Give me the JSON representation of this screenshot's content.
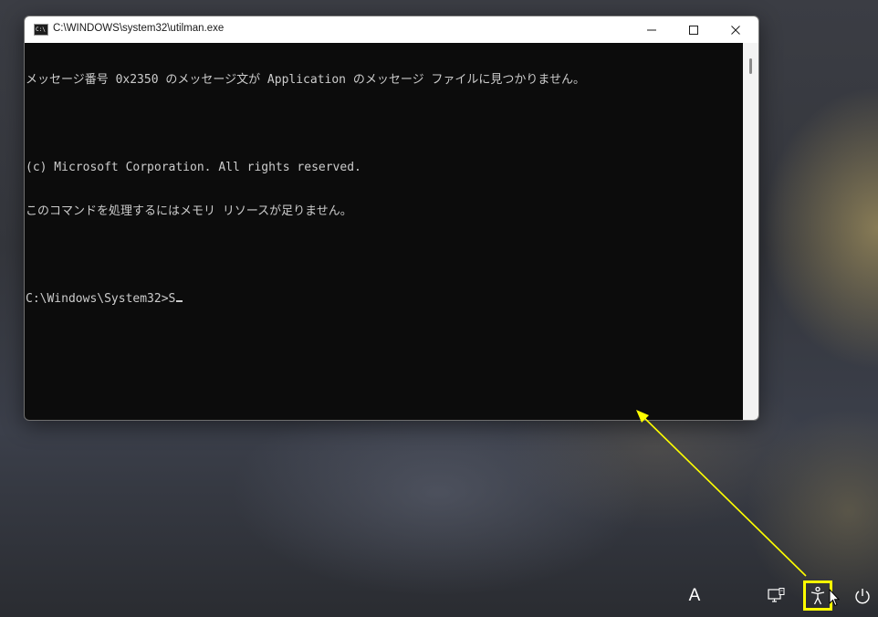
{
  "window": {
    "title": "C:\\WINDOWS\\system32\\utilman.exe",
    "icon_label": "C:\\",
    "controls": {
      "minimize": "minimize-icon",
      "maximize": "maximize-icon",
      "close": "close-icon"
    }
  },
  "terminal": {
    "lines": [
      "メッセージ番号 0x2350 のメッセージ文が Application のメッセージ ファイルに見つかりません。",
      "",
      "(c) Microsoft Corporation. All rights reserved.",
      "このコマンドを処理するにはメモリ リソースが足りません。",
      "",
      "C:\\Windows\\System32>S"
    ]
  },
  "taskbar": {
    "language_label": "A",
    "network_icon": "network-icon",
    "accessibility_icon": "accessibility-icon",
    "power_icon": "power-icon"
  },
  "annotation": {
    "highlight_color": "#ffff00"
  },
  "colors": {
    "terminal_bg": "#0c0c0c",
    "terminal_fg": "#cccccc",
    "accent": "#ffff00"
  }
}
